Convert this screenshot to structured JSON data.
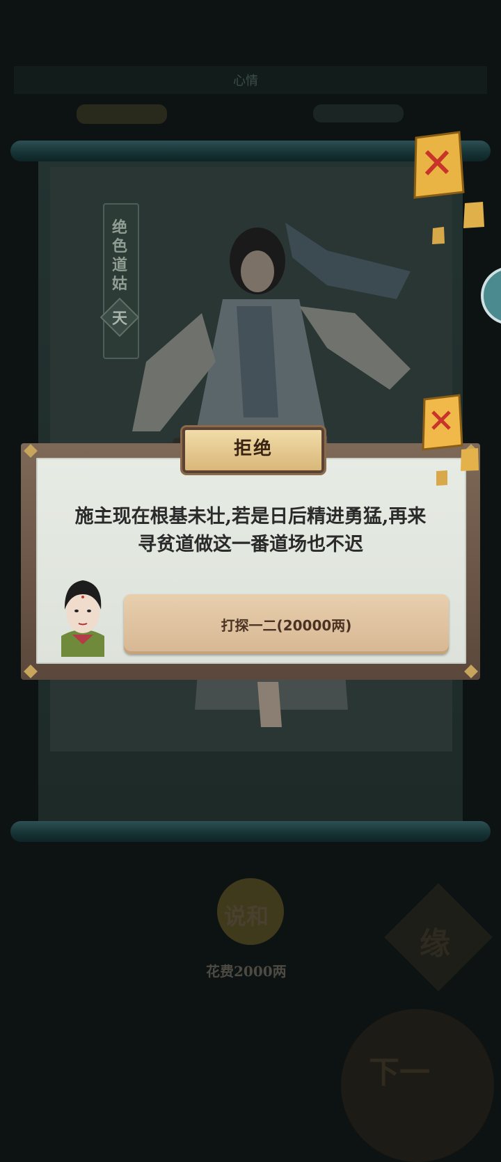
{
  "card": {
    "name_chars": [
      "绝",
      "色",
      "道",
      "姑"
    ],
    "rank": "天"
  },
  "dialog": {
    "title": "拒绝",
    "message_line1": "施主现在根基未壮,若是日后精进勇猛,再来",
    "message_line2": "寻贫道做这一番道场也不迟",
    "button_label": "打探一二(20000两)"
  },
  "background": {
    "mood_label": "心情",
    "mediate_label": "说和",
    "cost_label": "花费2000两",
    "fate_label": "缘",
    "next_label": "下一"
  },
  "colors": {
    "dialog_frame": "#6b5545",
    "dialog_bg": "#e3e8e1",
    "button": "#dec09c",
    "title_plaque": "#e6c98e"
  }
}
